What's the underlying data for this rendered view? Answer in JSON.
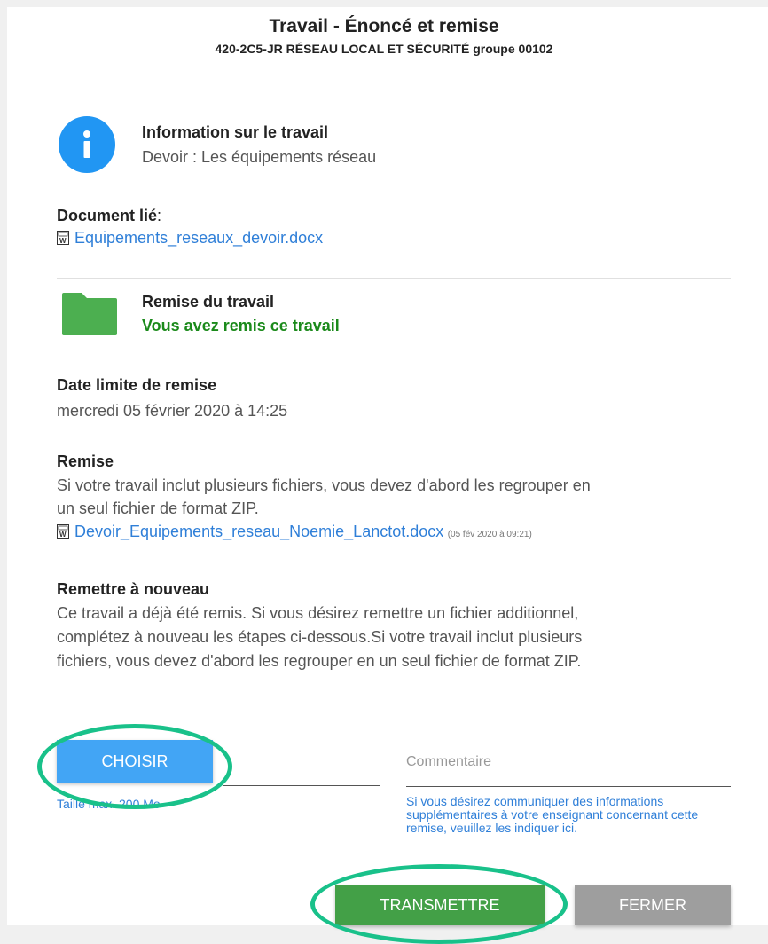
{
  "header": {
    "title": "Travail - Énoncé et remise",
    "subtitle": "420-2C5-JR RÉSEAU LOCAL ET SÉCURITÉ groupe 00102"
  },
  "info": {
    "heading": "Information sur le travail",
    "description": "Devoir : Les équipements réseau"
  },
  "linked_doc": {
    "label": "Document lié",
    "colon": ":",
    "file": "Equipements_reseaux_devoir.docx"
  },
  "submission": {
    "heading": "Remise du travail",
    "status": "Vous avez remis ce travail",
    "status_color": "#1b8a1b"
  },
  "deadline": {
    "heading": "Date limite de remise",
    "value": "mercredi 05 février 2020 à 14:25"
  },
  "remise": {
    "heading": "Remise",
    "text_line1": "Si votre travail inclut plusieurs fichiers, vous devez d'abord les regrouper en",
    "text_line2": "un seul fichier de format ZIP.",
    "file": "Devoir_Equipements_reseau_Noemie_Lanctot.docx",
    "file_date": "(05 fév 2020 à 09:21)"
  },
  "resubmit": {
    "heading": "Remettre à nouveau",
    "line1": "Ce travail a déjà été remis. Si vous désirez remettre un fichier additionnel,",
    "line2": "complétez à nouveau les étapes ci-dessous.Si votre travail inclut plusieurs",
    "line3": "fichiers, vous devez d'abord les regrouper en un seul fichier de format ZIP."
  },
  "upload": {
    "choose_label": "CHOISIR",
    "size_hint": "Taille max. 200 Mo"
  },
  "comment": {
    "label": "Commentaire",
    "help": "Si vous désirez communiquer des informations supplémentaires à votre enseignant concernant cette remise, veuillez les indiquer ici."
  },
  "actions": {
    "send_label": "TRANSMETTRE",
    "close_label": "FERMER"
  },
  "icons": {
    "info": "info-icon",
    "folder": "folder-icon",
    "word_doc": "word-document-icon"
  },
  "colors": {
    "info_blue": "#2196f3",
    "folder_green": "#4caf50",
    "link_blue": "#2f7fd8",
    "choose_blue": "#42a5f5",
    "send_green": "#43a047",
    "close_gray": "#9e9e9e",
    "highlight_ring": "#19c18a"
  }
}
